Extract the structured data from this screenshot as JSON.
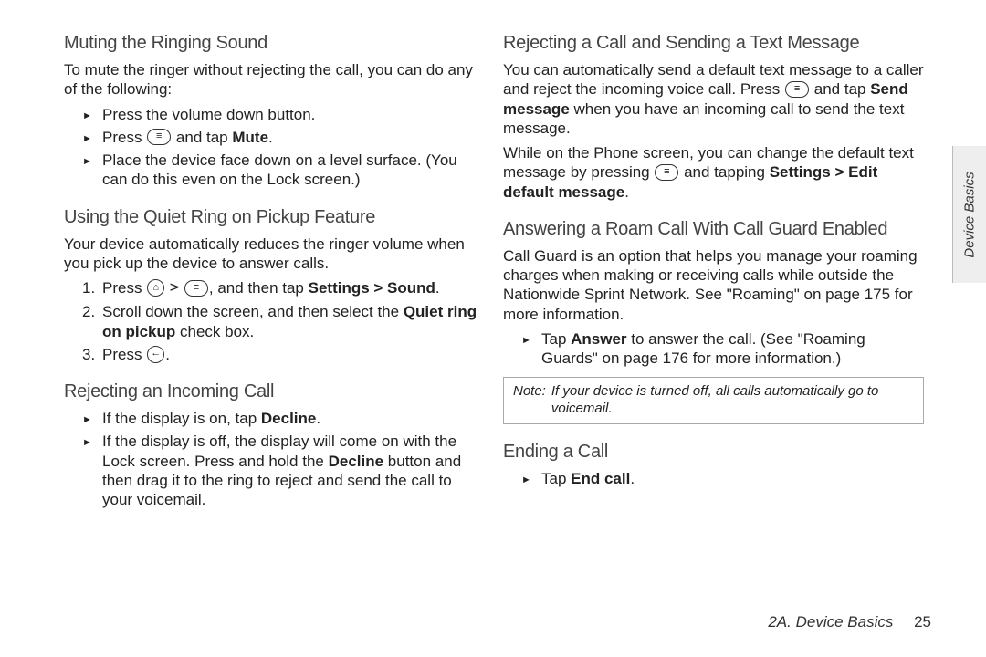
{
  "left": {
    "h1": "Muting the Ringing Sound",
    "p1": "To mute the ringer without rejecting the call, you can do any of the following:",
    "bul1": "Press the volume down button.",
    "bul2a": "Press ",
    "bul2b": " and tap ",
    "bul2c": "Mute",
    "bul2d": ".",
    "bul3": "Place the device face down on a level surface. (You can do this even on the Lock screen.)",
    "h2": "Using the Quiet Ring on Pickup Feature",
    "p2": "Your device automatically reduces the ringer volume when you pick up the device to answer calls.",
    "n1a": "Press ",
    "n1b": ", and then tap ",
    "n1c": "Settings > Sound",
    "n1d": ".",
    "n2a": "Scroll down the screen, and then select the ",
    "n2b": "Quiet ring on pickup",
    "n2c": " check box.",
    "n3a": "Press ",
    "n3b": ".",
    "h3": "Rejecting an Incoming Call",
    "rb1a": "If the display is on, tap ",
    "rb1b": "Decline",
    "rb1c": ".",
    "rb2a": "If the display is off, the display will come on with the Lock screen. Press and hold the ",
    "rb2b": "Decline",
    "rb2c": " button and then drag it to the ring to reject and send the call to your voicemail."
  },
  "right": {
    "h1": "Rejecting a Call and Sending a Text Message",
    "p1a": "You can automatically send a default text message to a caller and reject the incoming voice call. Press ",
    "p1b": " and tap ",
    "p1c": "Send message",
    "p1d": " when you have an incoming call to send the text message.",
    "p2a": "While on the Phone screen, you can change the default text message by pressing ",
    "p2b": " and tapping ",
    "p2c": "Settings > Edit default message",
    "p2d": ".",
    "h2": "Answering a Roam Call With Call Guard Enabled",
    "p3": "Call Guard is an option that helps you manage your roaming charges when making or receiving calls while outside the Nationwide Sprint Network. See \"Roaming\" on page 175 for more information.",
    "cb1a": "Tap ",
    "cb1b": "Answer",
    "cb1c": " to answer the call. (See \"Roaming Guards\" on page 176 for more information.)",
    "noteL": "Note:",
    "noteT": "If your device is turned off, all calls automatically go to voicemail.",
    "h3": "Ending a Call",
    "eb1a": "Tap ",
    "eb1b": "End call",
    "eb1c": "."
  },
  "footer": {
    "section": "2A. Device Basics",
    "page": "25"
  },
  "sidetab": "Device Basics",
  "markers": {
    "one": "1.",
    "two": "2.",
    "three": "3."
  },
  "glyphs": {
    "menu": "≡",
    "home": "⌂",
    "back": "←",
    "gt": ">"
  }
}
